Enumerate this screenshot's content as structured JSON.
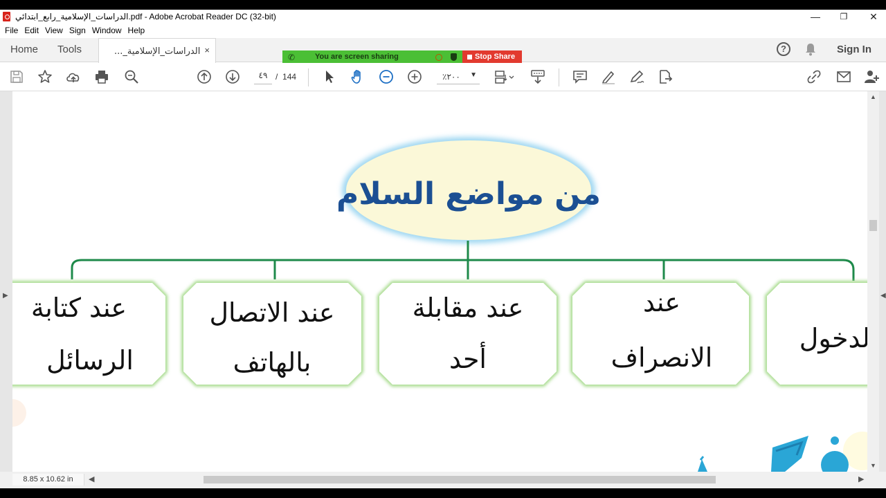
{
  "window": {
    "title": "الدراسات_الإسلامية_رابع_ابتدائي.pdf - Adobe Acrobat Reader DC (32-bit)",
    "minimize": "—",
    "maximize": "❐",
    "close": "✕"
  },
  "menu": [
    "File",
    "Edit",
    "View",
    "Sign",
    "Window",
    "Help"
  ],
  "tabs": {
    "home": "Home",
    "tools": "Tools",
    "document": "الدراسات_الإسلامية_...",
    "close": "×"
  },
  "screen_share": {
    "status": "You are screen sharing",
    "stop": "Stop Share",
    "colors": {
      "green": "#4bbf35",
      "red": "#e23a2f"
    }
  },
  "header": {
    "help": "?",
    "sign_in": "Sign In"
  },
  "toolbar": {
    "page_current": "٤٩",
    "page_sep": "/",
    "page_total": "144",
    "zoom": "٢٠٠٪",
    "zoom_arrow": "▼"
  },
  "document": {
    "page_size": "8.85 x 10.62 in",
    "diagram": {
      "center": "من مواضع السلام",
      "items": [
        {
          "line1": "عند كتابة",
          "line2": "الرسائل"
        },
        {
          "line1": "عند الاتصال",
          "line2": "بالهاتف"
        },
        {
          "line1": "عند مقابلة",
          "line2": "أحد"
        },
        {
          "line1": "عند",
          "line2": "الانصراف"
        },
        {
          "line1": "لدخول",
          "line2": ""
        }
      ],
      "colors": {
        "ellipse_fill": "#fbf8d8",
        "ellipse_glow": "#8fd0ef",
        "title_text": "#1b4f93",
        "connector": "#1e8a4a",
        "box_border": "#a9dc90"
      }
    }
  },
  "scroll": {
    "up": "▲",
    "down": "▼",
    "left": "◀",
    "right": "▶"
  }
}
